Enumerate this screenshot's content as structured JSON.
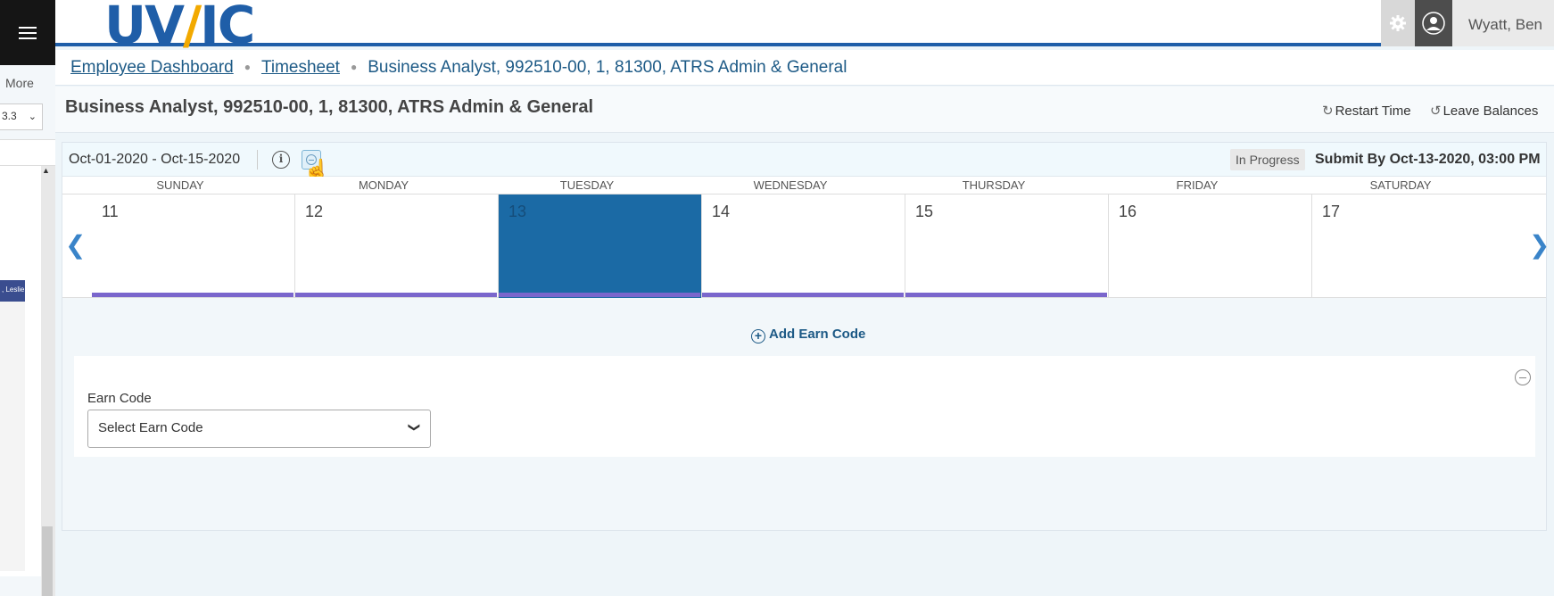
{
  "left_panel": {
    "more_label": "More",
    "select_value": "3.3",
    "thumb_text": ", Leslie"
  },
  "header": {
    "logo_text": "UVIC",
    "user_name": "Wyatt, Ben"
  },
  "breadcrumb": {
    "items": [
      "Employee Dashboard",
      "Timesheet",
      "Business Analyst, 992510-00, 1, 81300, ATRS Admin & General"
    ]
  },
  "title_row": {
    "title": "Business Analyst, 992510-00, 1, 81300, ATRS Admin & General",
    "restart_label": "Restart Time",
    "leave_label": "Leave Balances"
  },
  "calendar": {
    "period": "Oct-01-2020 - Oct-15-2020",
    "status": "In Progress",
    "submit_by": "Submit By Oct-13-2020, 03:00 PM",
    "days": [
      {
        "name": "SUNDAY",
        "date": "11",
        "bar": true
      },
      {
        "name": "MONDAY",
        "date": "12",
        "bar": true
      },
      {
        "name": "TUESDAY",
        "date": "13",
        "bar": true,
        "selected": true
      },
      {
        "name": "WEDNESDAY",
        "date": "14",
        "bar": true
      },
      {
        "name": "THURSDAY",
        "date": "15",
        "bar": true
      },
      {
        "name": "FRIDAY",
        "date": "16",
        "bar": false
      },
      {
        "name": "SATURDAY",
        "date": "17",
        "bar": false
      }
    ],
    "add_earn_label": "Add Earn Code",
    "earn_code_label": "Earn Code",
    "earn_code_placeholder": "Select Earn Code"
  },
  "colors": {
    "brand_blue": "#1f5ea8",
    "selected_day": "#1b6aa5",
    "hours_bar": "#7a66cc"
  }
}
